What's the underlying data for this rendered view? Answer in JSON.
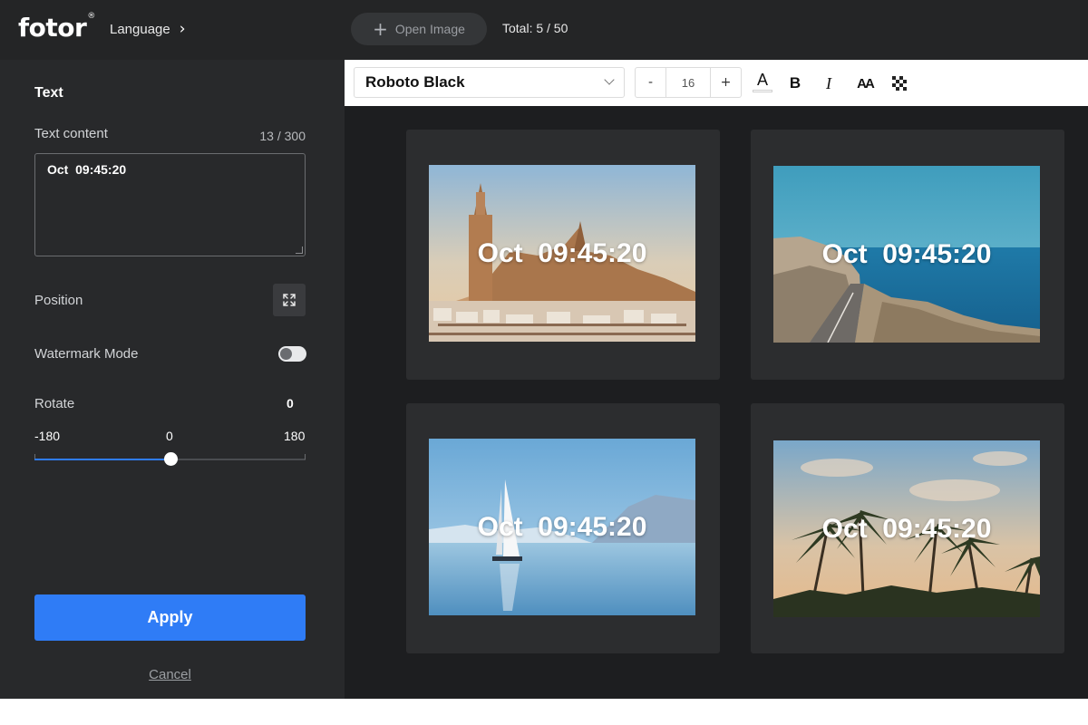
{
  "app": {
    "logo": "fotor",
    "logo_mark": "®",
    "language_label": "Language",
    "open_image_label": "Open Image",
    "total_label": "Total: 5 / 50"
  },
  "sidebar": {
    "section_title": "Text",
    "text_content_label": "Text content",
    "char_count": "13 / 300",
    "text_value": "Oct  09:45:20",
    "position_label": "Position",
    "watermark_mode_label": "Watermark Mode",
    "watermark_mode_on": false,
    "rotate_label": "Rotate",
    "rotate_value": "0",
    "rotate_min": "-180",
    "rotate_mid": "0",
    "rotate_max": "180",
    "rotate_fraction": 0.5,
    "apply_label": "Apply",
    "cancel_label": "Cancel"
  },
  "toolbar": {
    "font_name": "Roboto Black",
    "size_minus": "-",
    "font_size": "16",
    "size_plus": "+",
    "color_letter": "A",
    "bold_label": "B",
    "italic_label": "I",
    "case_label": "AA",
    "icons": [
      "font-color-icon",
      "bold-icon",
      "italic-icon",
      "text-case-icon",
      "opacity-icon"
    ]
  },
  "canvas": {
    "images": [
      {
        "subject": "cathedral",
        "watermark": "Oct  09:45:20"
      },
      {
        "subject": "coastal-road",
        "watermark": "Oct  09:45:20"
      },
      {
        "subject": "sailboat",
        "watermark": "Oct  09:45:20"
      },
      {
        "subject": "palm-trees",
        "watermark": "Oct  09:45:20"
      }
    ]
  },
  "colors": {
    "accent": "#2f7cf6",
    "sidebar_bg": "#28292b",
    "topbar_bg": "#242526",
    "canvas_bg": "#1d1e20",
    "card_bg": "#2c2d2f"
  }
}
